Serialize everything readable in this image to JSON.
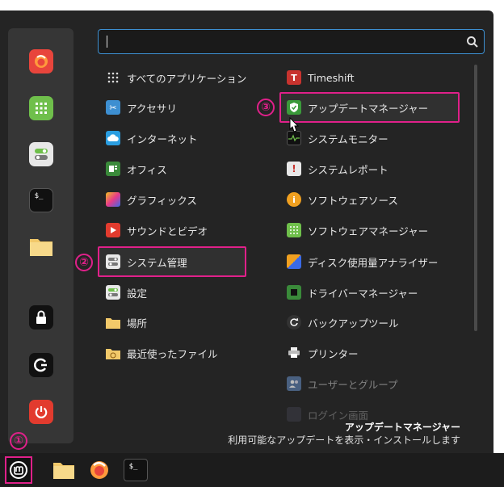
{
  "search": {
    "value": "",
    "placeholder": ""
  },
  "favorites": [
    {
      "name": "firefox-icon",
      "color": "#e8453c"
    },
    {
      "name": "calculator-icon",
      "color": "#6fbf4b"
    },
    {
      "name": "settings-toggle-icon",
      "color": "#e8e8e8"
    },
    {
      "name": "terminal-icon",
      "color": "#111111"
    },
    {
      "name": "folder-icon",
      "color": "#f2c96a"
    },
    {
      "name": "lock-icon",
      "color": "#111111"
    },
    {
      "name": "logout-icon",
      "color": "#111111"
    },
    {
      "name": "power-icon",
      "color": "#e23b2e"
    }
  ],
  "categories": [
    {
      "label": "すべてのアプリケーション",
      "icon": "grid-icon"
    },
    {
      "label": "アクセサリ",
      "icon": "scissors-icon"
    },
    {
      "label": "インターネット",
      "icon": "cloud-icon"
    },
    {
      "label": "オフィス",
      "icon": "office-icon"
    },
    {
      "label": "グラフィックス",
      "icon": "graphics-icon"
    },
    {
      "label": "サウンドとビデオ",
      "icon": "play-icon"
    },
    {
      "label": "システム管理",
      "icon": "system-admin-icon"
    },
    {
      "label": "設定",
      "icon": "settings-icon"
    },
    {
      "label": "場所",
      "icon": "folder-icon"
    },
    {
      "label": "最近使ったファイル",
      "icon": "recent-icon"
    }
  ],
  "apps": [
    {
      "label": "Timeshift",
      "icon": "timeshift-icon"
    },
    {
      "label": "アップデートマネージャー",
      "icon": "shield-icon"
    },
    {
      "label": "システムモニター",
      "icon": "monitor-icon"
    },
    {
      "label": "システムレポート",
      "icon": "report-icon"
    },
    {
      "label": "ソフトウェアソース",
      "icon": "info-icon"
    },
    {
      "label": "ソフトウェアマネージャー",
      "icon": "software-manager-icon"
    },
    {
      "label": "ディスク使用量アナライザー",
      "icon": "disk-icon"
    },
    {
      "label": "ドライバーマネージャー",
      "icon": "driver-icon"
    },
    {
      "label": "バックアップツール",
      "icon": "backup-icon"
    },
    {
      "label": "プリンター",
      "icon": "printer-icon"
    },
    {
      "label": "ユーザーとグループ",
      "icon": "users-icon"
    },
    {
      "label": "ログイン画面",
      "icon": "login-icon"
    }
  ],
  "annotations": {
    "one": "①",
    "two": "②",
    "three": "③"
  },
  "description": {
    "title": "アップデートマネージャー",
    "text": "利用可能なアップデートを表示・インストールします"
  },
  "colors": {
    "highlight": "#e0208a",
    "menu_bg": "#242424",
    "accent": "#3d8fd1"
  }
}
